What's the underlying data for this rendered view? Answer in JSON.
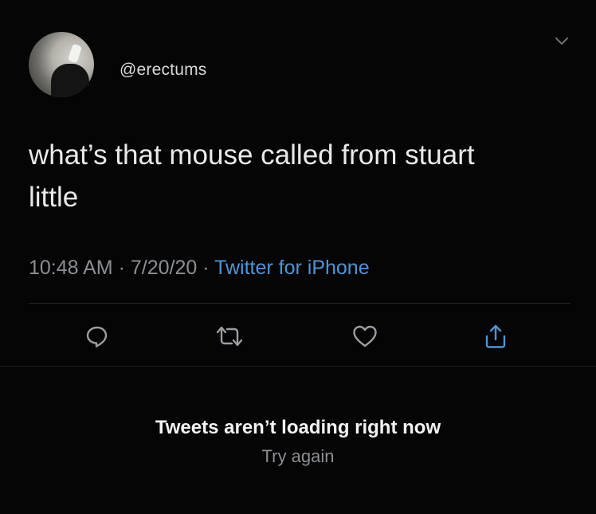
{
  "tweet": {
    "handle": "@erectums",
    "text_line1": "what’s that mouse called from stuart",
    "text_line2": "little",
    "time": "10:48 AM",
    "separator": "·",
    "date": "7/20/20",
    "source": "Twitter for iPhone"
  },
  "actions": {
    "icons": [
      "reply-icon",
      "retweet-icon",
      "like-icon",
      "share-icon"
    ]
  },
  "error": {
    "message": "Tweets aren’t loading right now",
    "retry_label": "Try again"
  },
  "colors": {
    "background": "#050505",
    "text": "#e9e9ea",
    "muted": "#8b8f94",
    "link": "#4f94d4"
  }
}
